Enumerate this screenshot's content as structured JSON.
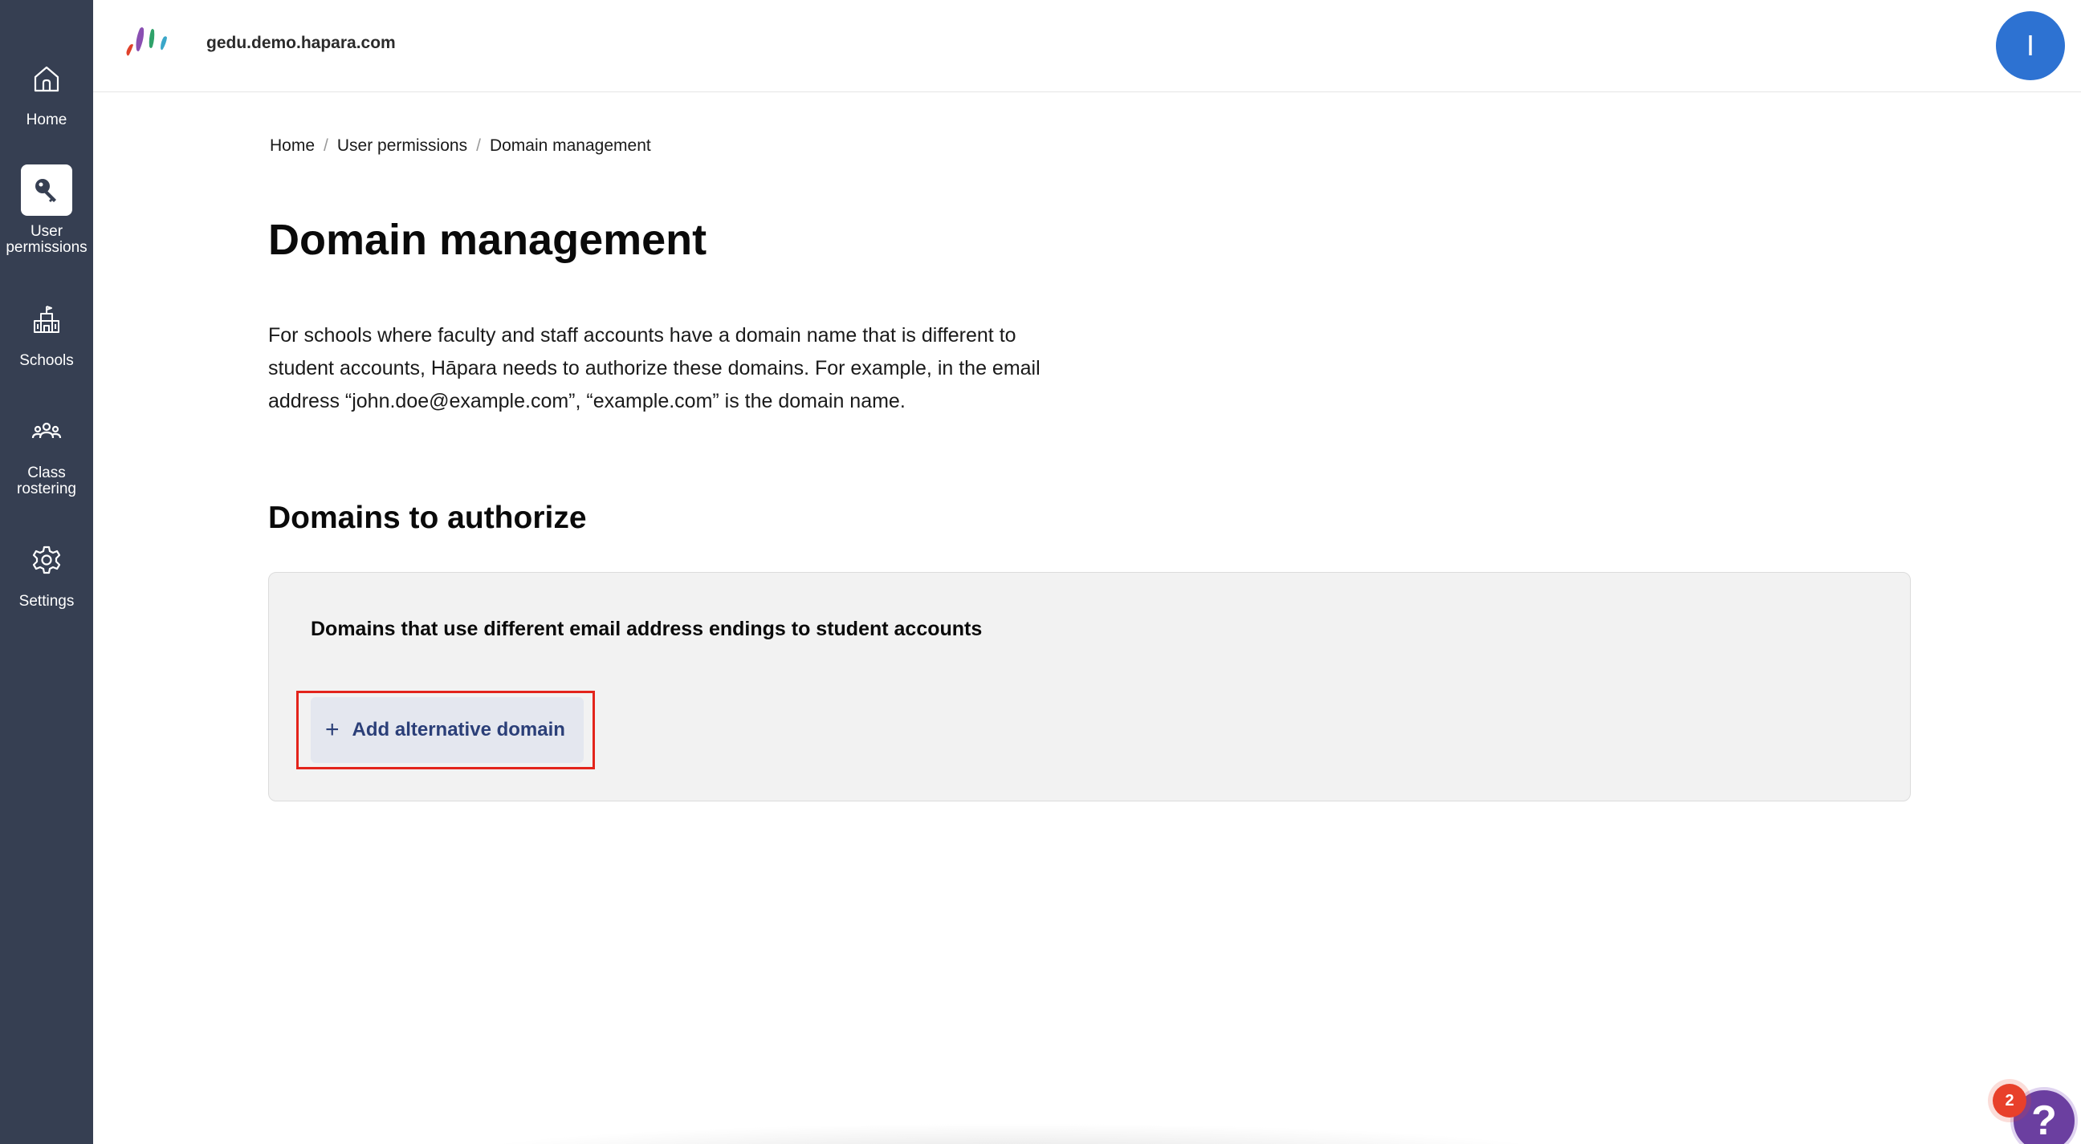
{
  "sidebar": {
    "items": [
      {
        "label": "Home",
        "icon": "home-icon",
        "active": false
      },
      {
        "label": "User permissions",
        "icon": "key-icon",
        "active": true
      },
      {
        "label": "Schools",
        "icon": "school-icon",
        "active": false
      },
      {
        "label": "Class rostering",
        "icon": "group-icon",
        "active": false
      },
      {
        "label": "Settings",
        "icon": "gear-icon",
        "active": false
      }
    ]
  },
  "header": {
    "domain": "gedu.demo.hapara.com",
    "avatar_initial": "I"
  },
  "breadcrumb": [
    "Home",
    "User permissions",
    "Domain management"
  ],
  "page": {
    "title": "Domain management",
    "description": "For schools where faculty and staff accounts have a domain name that is different to student accounts, Hāpara needs to authorize these domains. For example, in the email address “john.doe@example.com”, “example.com” is the domain name.",
    "section_title": "Domains to authorize",
    "panel_title": "Domains that use different email address endings to student accounts",
    "add_button": {
      "icon": "plus-icon",
      "label": "Add alternative domain"
    }
  },
  "help": {
    "badge_count": "2",
    "icon": "help-icon"
  },
  "colors": {
    "sidebar_bg": "#363f52",
    "avatar_bg": "#2d72d2",
    "highlight": "#e3241b",
    "help_bg": "#6b3fa0",
    "badge_bg": "#e8402a"
  }
}
